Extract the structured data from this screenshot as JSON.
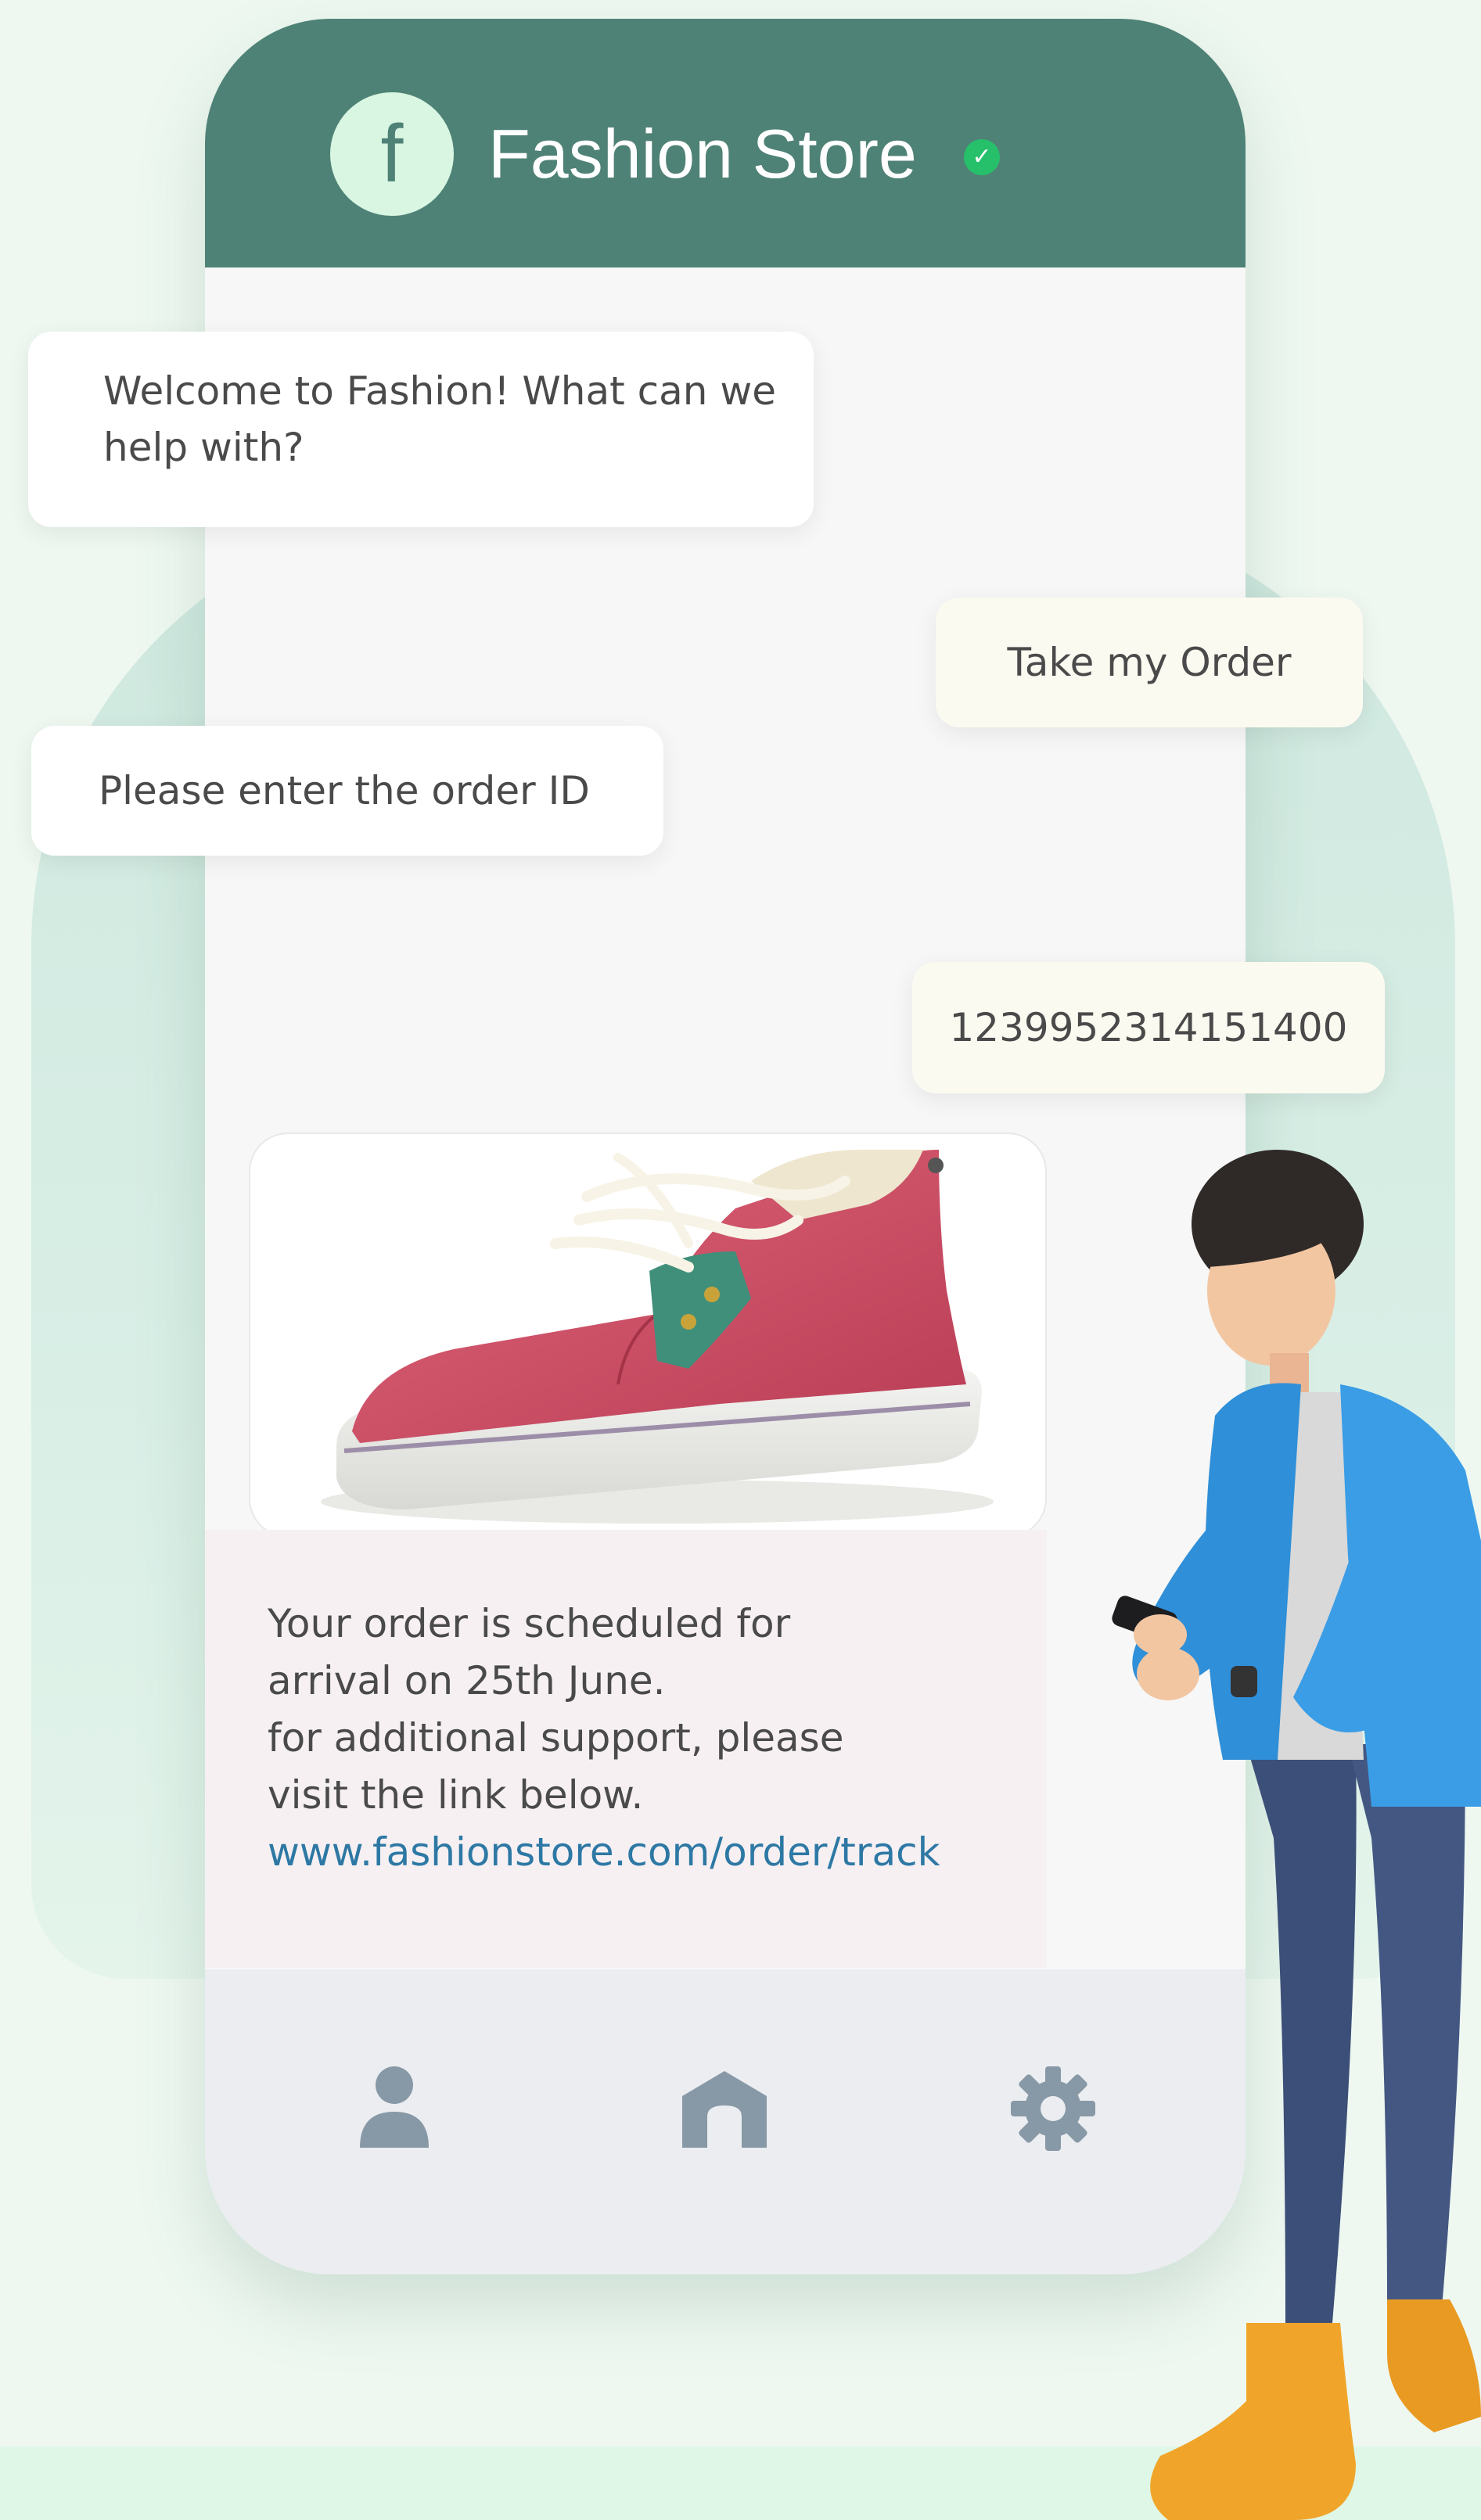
{
  "header": {
    "store_name": "Fashion Store",
    "logo_letter": "f"
  },
  "chat": {
    "messages": [
      {
        "from": "bot",
        "text": "Welcome to Fashion! What can we help with?"
      },
      {
        "from": "user",
        "text": "Take my Order"
      },
      {
        "from": "bot",
        "text": "Please enter the order ID"
      },
      {
        "from": "user",
        "text": "1239952314151400"
      }
    ],
    "order_message": {
      "lines": [
        "Your order is scheduled for",
        "arrival on 25th June.",
        "for additional support, please",
        "visit the link below."
      ],
      "link": "www.fashionstore.com/order/track"
    }
  },
  "nav": {
    "items": [
      {
        "icon": "user-icon"
      },
      {
        "icon": "home-icon"
      },
      {
        "icon": "gear-icon"
      }
    ]
  },
  "colors": {
    "header": "#4f8276",
    "verified": "#26c06a",
    "link": "#2d78a4",
    "nav_icon": "#8798a6",
    "shoe": "#d24e64"
  }
}
